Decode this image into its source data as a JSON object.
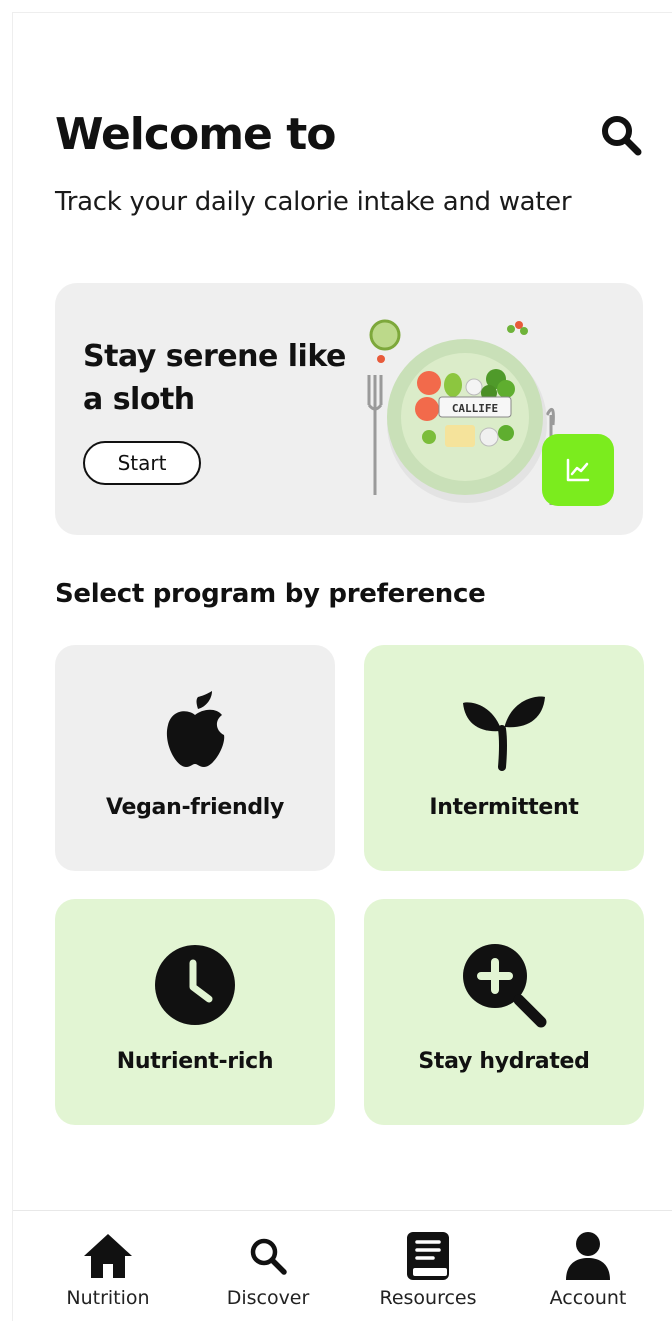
{
  "header": {
    "title": "Welcome to",
    "search_icon": "search-icon"
  },
  "subtitle": "Track your daily calorie intake and water",
  "hero": {
    "title": "Stay serene like a sloth",
    "start_label": "Start",
    "plate_label": "CALLIFE",
    "chart_icon": "chart-line-icon",
    "accent_color": "#7bec1e",
    "background_color": "#efefef"
  },
  "programs": {
    "section_title": "Select program by preference",
    "items": [
      {
        "label": "Vegan-friendly",
        "icon": "apple-icon",
        "background": "#efefef"
      },
      {
        "label": "Intermittent",
        "icon": "sprout-icon",
        "background": "#e2f5d3"
      },
      {
        "label": "Nutrient-rich",
        "icon": "clock-icon",
        "background": "#e2f5d3"
      },
      {
        "label": "Stay hydrated",
        "icon": "zoom-in-icon",
        "background": "#e2f5d3"
      }
    ]
  },
  "nav": {
    "items": [
      {
        "label": "Nutrition",
        "icon": "home-icon"
      },
      {
        "label": "Discover",
        "icon": "search-icon"
      },
      {
        "label": "Resources",
        "icon": "book-icon"
      },
      {
        "label": "Account",
        "icon": "user-icon"
      }
    ]
  }
}
